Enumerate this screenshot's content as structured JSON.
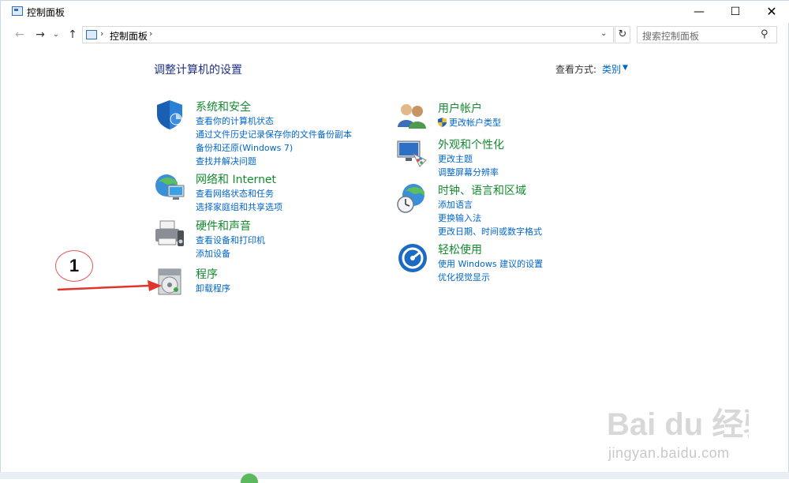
{
  "window": {
    "title": "控制面板",
    "min_label": "—",
    "max_label": "☐",
    "close_label": "✕"
  },
  "nav": {
    "back": "←",
    "forward": "→",
    "recent": "⌄",
    "up": "↑",
    "address_sep": "›",
    "address_path": "控制面板",
    "address_dropdown": "⌄",
    "refresh": "↻",
    "search_placeholder": "搜索控制面板",
    "search_icon": "⚲"
  },
  "content": {
    "page_title": "调整计算机的设置",
    "view_by_label": "查看方式:",
    "view_by_value": "类别",
    "view_by_caret": "▼"
  },
  "categories_left": [
    {
      "icon": "shield-icon",
      "heading": "系统和安全",
      "links": [
        "查看你的计算机状态",
        "通过文件历史记录保存你的文件备份副本",
        "备份和还原(Windows 7)",
        "查找并解决问题"
      ]
    },
    {
      "icon": "network-globe-icon",
      "heading": "网络和 Internet",
      "links": [
        "查看网络状态和任务",
        "选择家庭组和共享选项"
      ]
    },
    {
      "icon": "printer-icon",
      "heading": "硬件和声音",
      "links": [
        "查看设备和打印机",
        "添加设备"
      ]
    },
    {
      "icon": "programs-disc-icon",
      "heading": "程序",
      "links": [
        "卸载程序"
      ]
    }
  ],
  "categories_right": [
    {
      "icon": "users-icon",
      "heading": "用户帐户",
      "links": [
        "更改帐户类型"
      ]
    },
    {
      "icon": "monitor-palette-icon",
      "heading": "外观和个性化",
      "links": [
        "更改主题",
        "调整屏幕分辨率"
      ]
    },
    {
      "icon": "clock-globe-icon",
      "heading": "时钟、语言和区域",
      "links": [
        "添加语言",
        "更换输入法",
        "更改日期、时间或数字格式"
      ]
    },
    {
      "icon": "ease-of-access-icon",
      "heading": "轻松使用",
      "links": [
        "使用 Windows 建议的设置",
        "优化视觉显示"
      ]
    }
  ],
  "annotation": {
    "number": "1",
    "color": "#e0352b"
  },
  "watermark": {
    "brand": "Bai du 经验",
    "url": "jingyan.baidu.com"
  },
  "colors": {
    "heading_green": "#138a2e",
    "link_blue": "#0066cc",
    "title_blue": "#1e3287"
  }
}
